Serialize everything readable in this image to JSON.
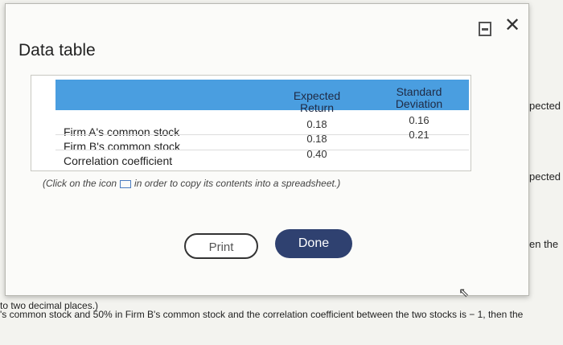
{
  "dialog": {
    "title": "Data table",
    "close_glyph": "✕"
  },
  "table": {
    "headers": {
      "expected_return": "Expected\nReturn",
      "standard_deviation": "Standard\nDeviation"
    },
    "rows": [
      {
        "label": "Firm A's common stock",
        "expected_return": "0.18",
        "standard_deviation": "0.16"
      },
      {
        "label": "Firm B's common stock",
        "expected_return": "0.18",
        "standard_deviation": "0.21"
      },
      {
        "label": "Correlation coefficient",
        "expected_return": "0.40",
        "standard_deviation": ""
      }
    ]
  },
  "note": {
    "before_icon": "(Click on the icon",
    "after_icon": "in order to copy its contents into a spreadsheet.)"
  },
  "buttons": {
    "print": "Print",
    "done": "Done"
  },
  "background": {
    "right_fragments": [
      "pected",
      "pected",
      "en the"
    ],
    "bottom_lines": [
      "to two decimal places.)",
      "'s common stock and 50% in Firm B's common stock and the correlation coefficient between the two stocks is  − 1, then the"
    ]
  },
  "icons": {
    "minimize": "minimize-icon",
    "close": "close-icon",
    "copy": "spreadsheet-copy-icon",
    "cursor": "pointer-cursor-icon"
  }
}
